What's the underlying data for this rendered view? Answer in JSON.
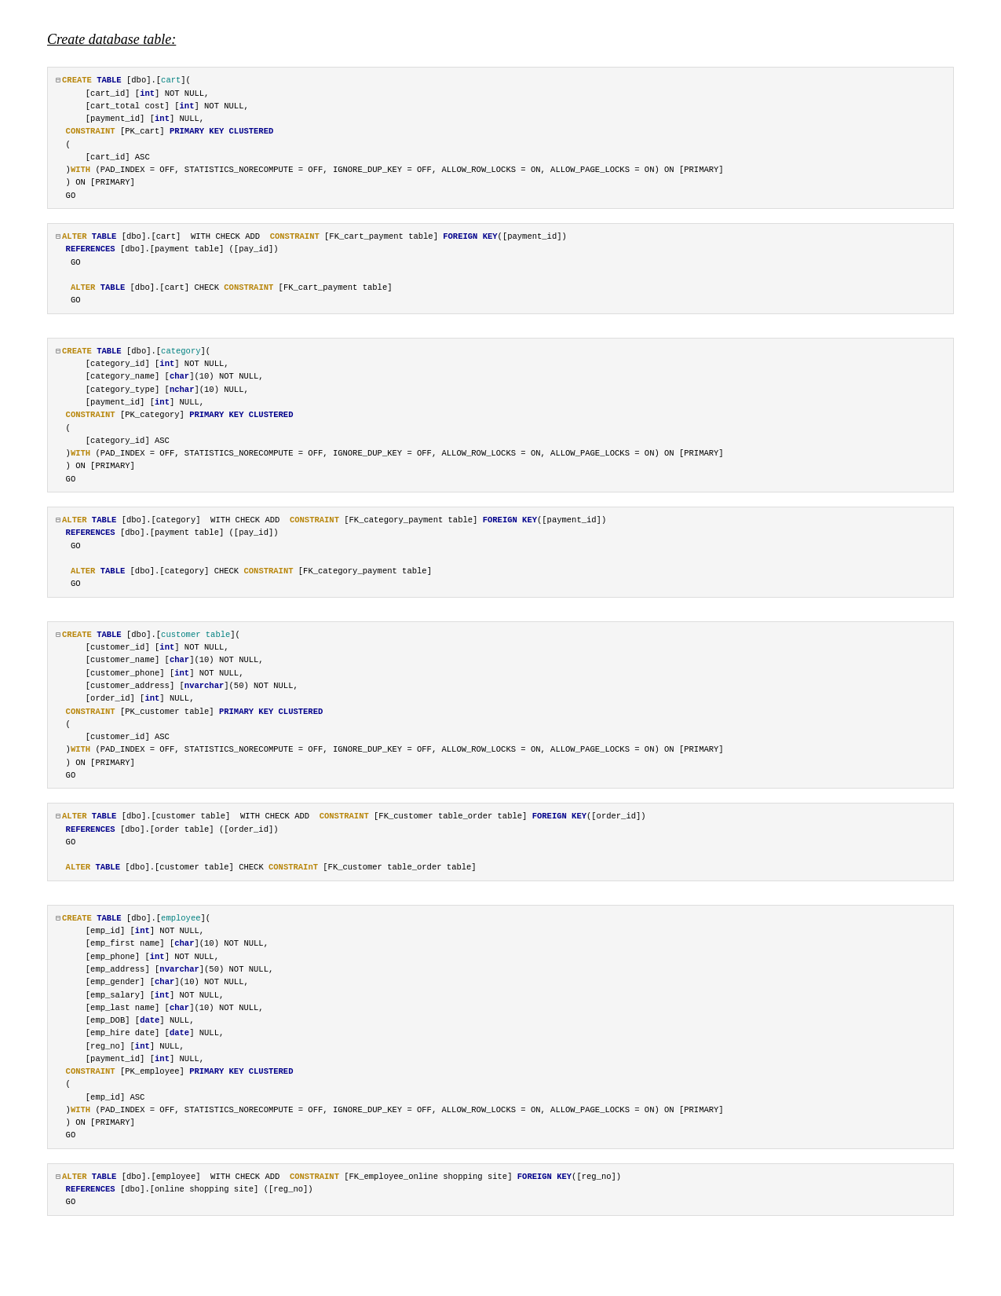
{
  "page": {
    "title": "Create database table:"
  },
  "blocks": [
    {
      "id": "cart-table",
      "content": "cart_create"
    },
    {
      "id": "category-table",
      "content": "category_create"
    },
    {
      "id": "customer-table",
      "content": "customer_create"
    },
    {
      "id": "employee-table",
      "content": "employee_create"
    }
  ]
}
